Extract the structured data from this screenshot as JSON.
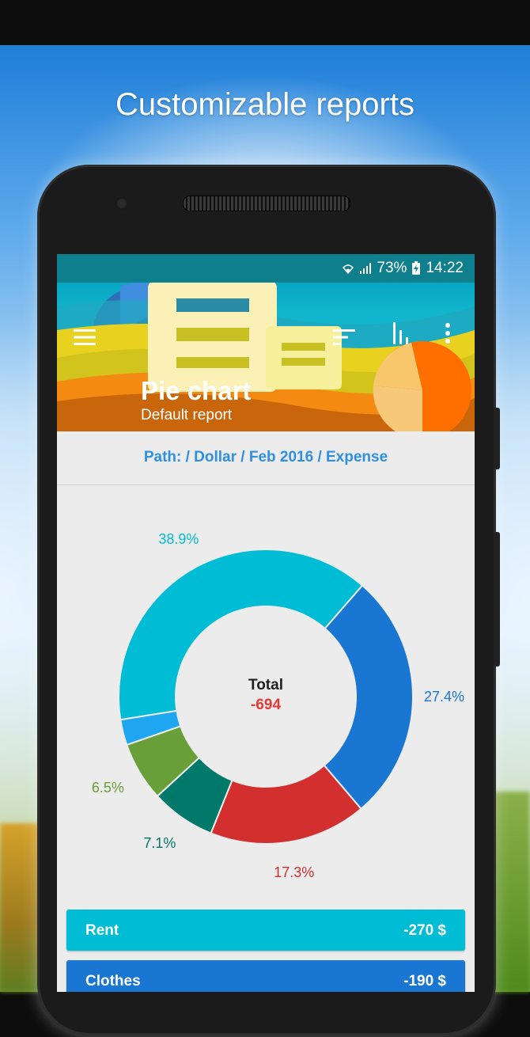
{
  "headline": "Customizable reports",
  "status": {
    "battery": "73%",
    "time": "14:22"
  },
  "appbar": {
    "title": "Pie chart",
    "subtitle": "Default report",
    "icons": [
      "menu-icon",
      "sort-icon",
      "bar-chart-icon",
      "more-vert-icon"
    ]
  },
  "path_text": "Path:  / Dollar / Feb 2016 / Expense",
  "center": {
    "label": "Total",
    "value": "-694"
  },
  "chart_data": {
    "type": "pie",
    "donut": true,
    "slices": [
      {
        "label": "38.9%",
        "value": 38.9,
        "color": "#00bcd4"
      },
      {
        "label": "27.4%",
        "value": 27.4,
        "color": "#1976d2"
      },
      {
        "label": "17.3%",
        "value": 17.3,
        "color": "#d32f2f"
      },
      {
        "label": "7.1%",
        "value": 7.1,
        "color": "#00796b"
      },
      {
        "label": "6.5%",
        "value": 6.5,
        "color": "#689f38"
      },
      {
        "label": "",
        "value": 2.8,
        "color": "#1ea7f0"
      }
    ]
  },
  "rows": [
    {
      "label": "Rent",
      "amount": "-270 $",
      "color": "#00bcd4"
    },
    {
      "label": "Clothes",
      "amount": "-190 $",
      "color": "#1976d2"
    }
  ]
}
